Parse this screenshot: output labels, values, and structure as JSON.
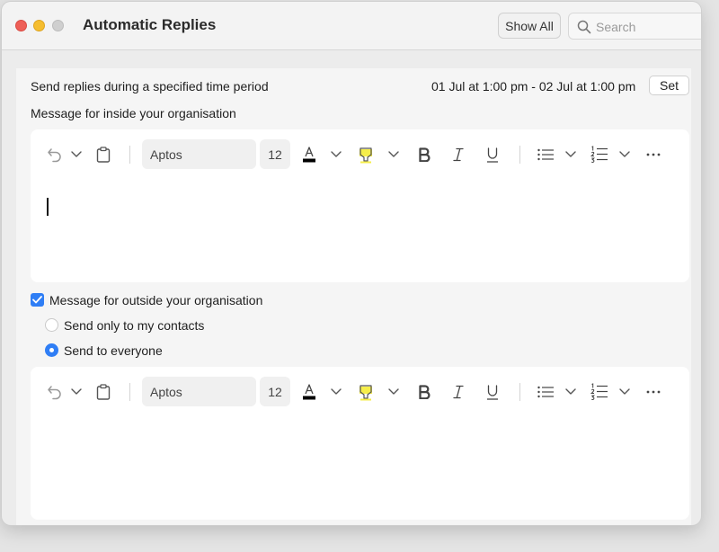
{
  "window": {
    "title": "Automatic Replies",
    "show_all_label": "Show All",
    "search_placeholder": "Search"
  },
  "schedule": {
    "label": "Send replies during a specified time period",
    "range": "01 Jul at 1:00 pm - 02 Jul at 1:00 pm",
    "set_label": "Set"
  },
  "inside": {
    "label": "Message for inside your organisation",
    "toolbar": {
      "font": "Aptos",
      "size": "12"
    }
  },
  "outside": {
    "checkbox_label": "Message for outside your organisation",
    "checked": true,
    "options": [
      {
        "label": "Send only to my contacts",
        "selected": false
      },
      {
        "label": "Send to everyone",
        "selected": true
      }
    ],
    "toolbar": {
      "font": "Aptos",
      "size": "12"
    }
  },
  "colors": {
    "accent": "#2f7ef5",
    "highlight": "#f6ee4a",
    "font_color_bar": "#000000"
  },
  "icons": [
    "undo-icon",
    "chevron-down-icon",
    "clipboard-icon",
    "font-color-icon",
    "highlight-icon",
    "bold-icon",
    "italic-icon",
    "underline-icon",
    "bullet-list-icon",
    "numbered-list-icon",
    "more-icon",
    "search-icon"
  ]
}
